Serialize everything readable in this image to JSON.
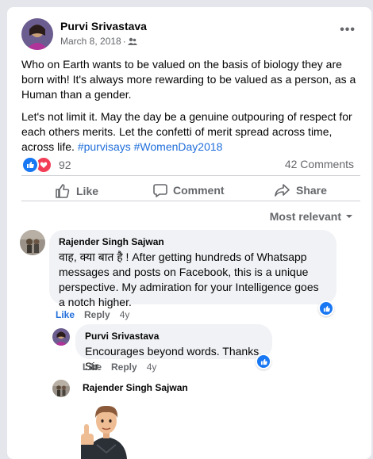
{
  "post": {
    "author": "Purvi Srivastava",
    "date": "March 8, 2018",
    "dot": "·",
    "more_label": "•••",
    "paragraph1": "Who on Earth wants to be valued on the basis of biology they are born with! It's always more rewarding to be valued as a person, as a Human than a gender.",
    "paragraph2_text": "Let's not limit it. May the day be a genuine outpouring of respect for each others merits. Let the confetti of merit spread across time, across life.",
    "hashtag1": "#purvisays",
    "hashtag2": "#WomenDay2018",
    "reaction_count": "92",
    "comment_count": "42 Comments"
  },
  "actions": {
    "like": "Like",
    "comment": "Comment",
    "share": "Share"
  },
  "sort_label": "Most relevant",
  "comments": [
    {
      "author": "Rajender Singh Sajwan",
      "text": "वाह, क्या बात है ! After getting hundreds of Whatsapp messages and posts on Facebook, this is a unique perspective. My admiration for your Intelligence goes a notch higher.",
      "like_label": "Like",
      "reply_label": "Reply",
      "time": "4y"
    },
    {
      "author": "Purvi Srivastava",
      "text": "Encourages beyond words. Thanks, Sir.",
      "like_label": "Like",
      "reply_label": "Reply",
      "time": "4y"
    },
    {
      "author": "Rajender Singh Sajwan"
    }
  ],
  "colors": {
    "accent": "#1877f2",
    "link": "#216fdb",
    "love": "#f33e58",
    "muted": "#65676b"
  }
}
